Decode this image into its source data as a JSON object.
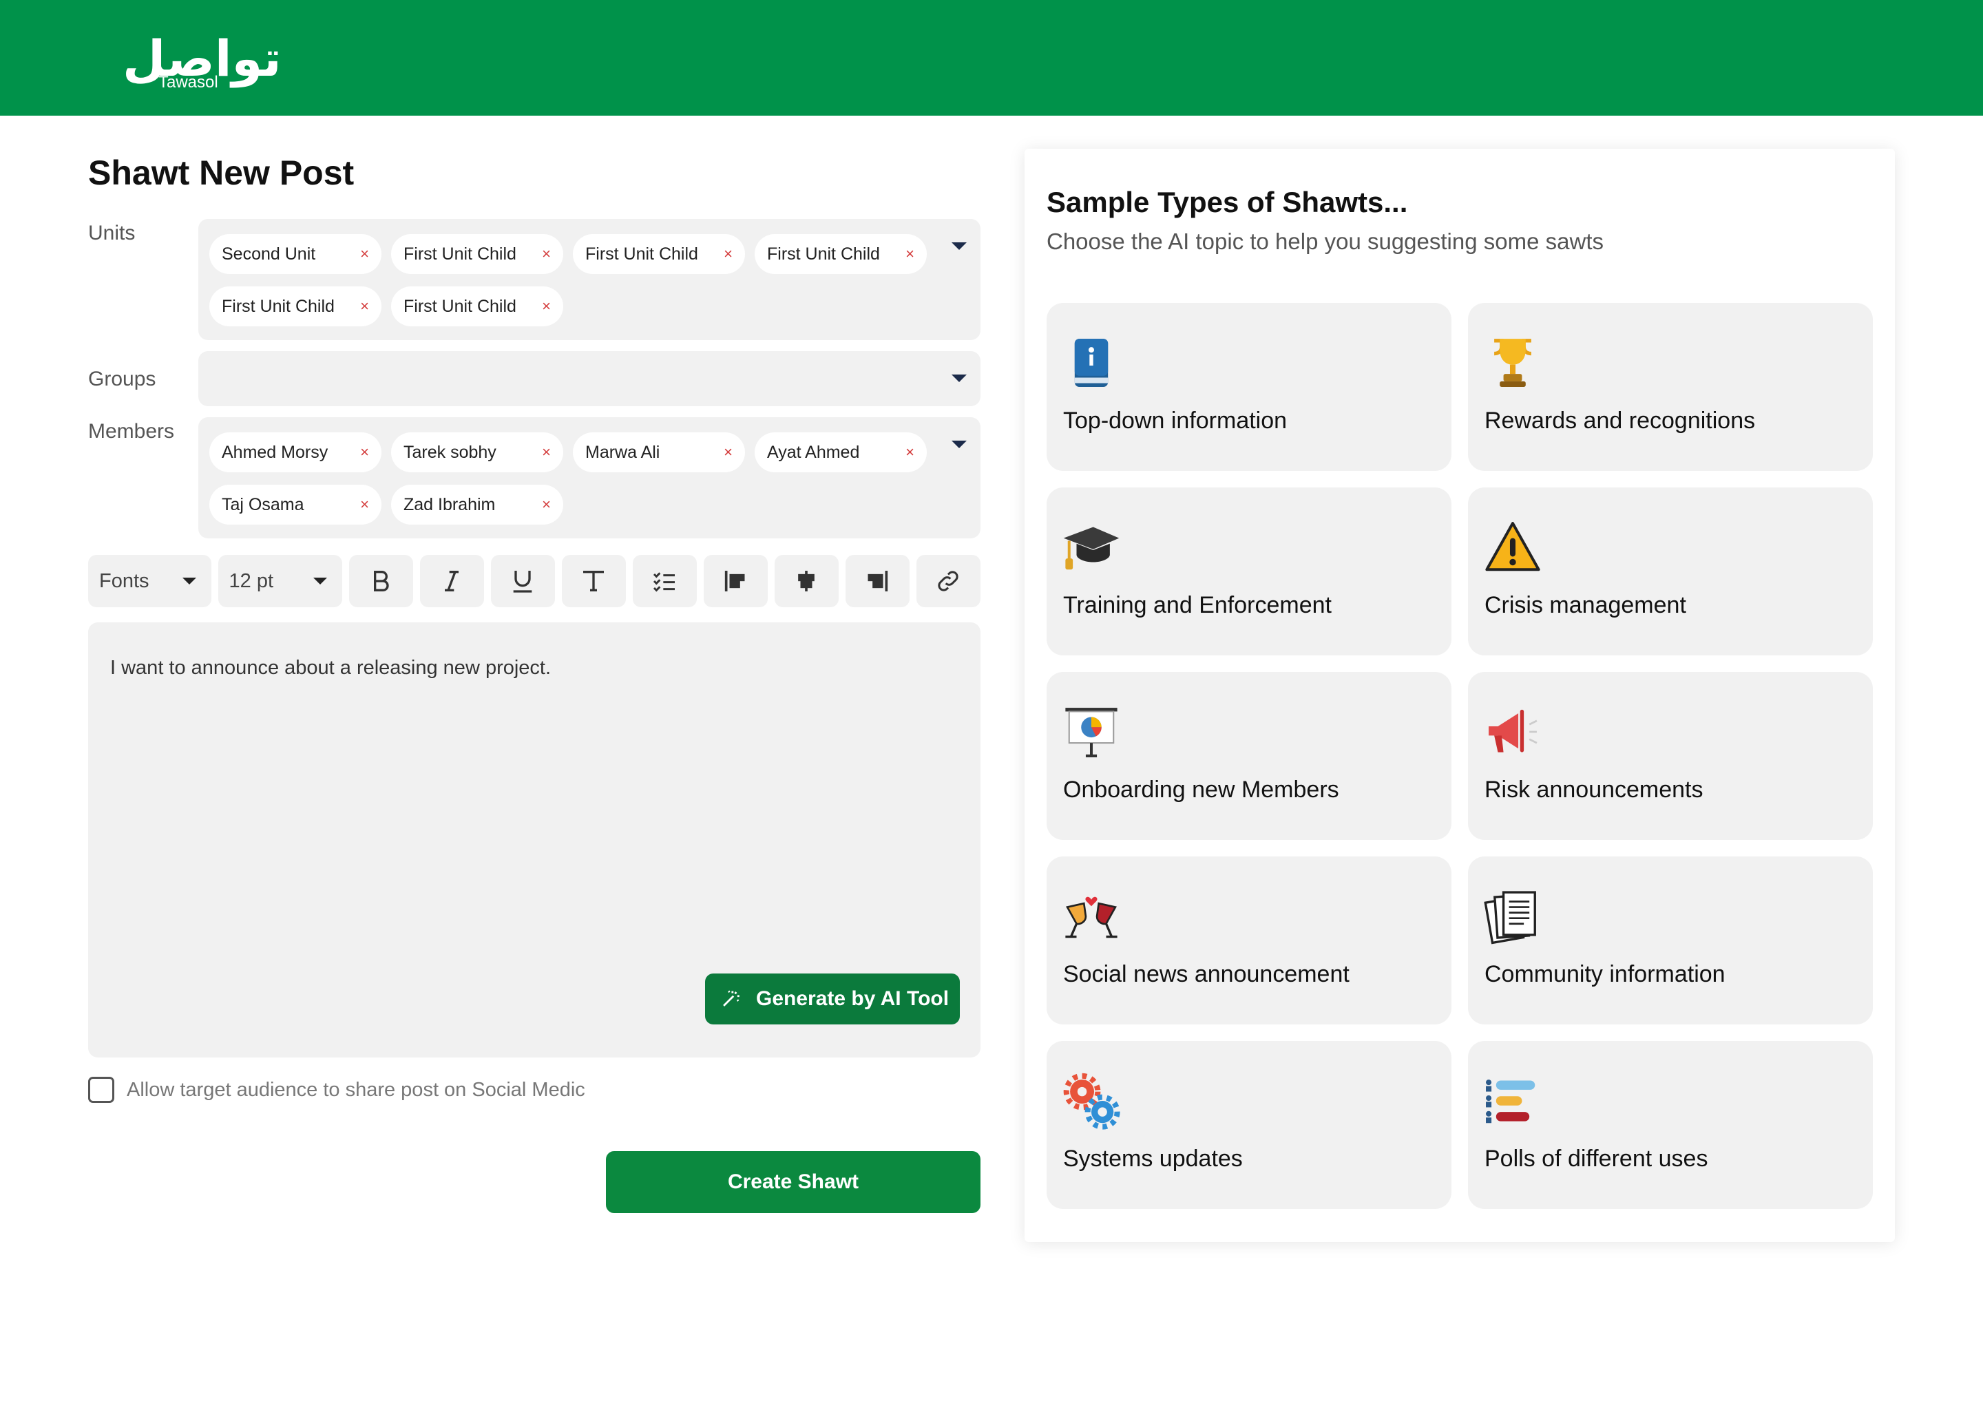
{
  "brand": {
    "logo_arabic": "تواصل",
    "logo_english": "Tawasol",
    "color": "#00924a"
  },
  "page_title": "Shawt New Post",
  "units": {
    "label": "Units",
    "chips": [
      "Second Unit",
      "First Unit Child",
      "First Unit Child",
      "First Unit Child",
      "First Unit Child",
      "First Unit Child"
    ]
  },
  "groups": {
    "label": "Groups",
    "chips": []
  },
  "members": {
    "label": "Members",
    "chips": [
      "Ahmed Morsy",
      "Tarek sobhy",
      "Marwa Ali",
      "Ayat Ahmed",
      "Taj Osama",
      "Zad Ibrahim"
    ]
  },
  "chip_remove_glyph": "×",
  "toolbar": {
    "font_select": "Fonts",
    "size_select": "12 pt",
    "buttons": [
      "bold-icon",
      "italic-icon",
      "underline-icon",
      "text-format-icon",
      "checklist-icon",
      "align-left-icon",
      "align-center-icon",
      "align-right-icon",
      "link-icon"
    ]
  },
  "editor": {
    "text": "I want to announce about a releasing new project."
  },
  "ai_button": {
    "label": "Generate by AI Tool"
  },
  "share_checkbox": {
    "label": "Allow target audience to share post on Social Medic",
    "checked": false
  },
  "create_button": {
    "label": "Create Shawt"
  },
  "samples": {
    "title": "Sample Types of Shawts...",
    "subtitle": "Choose the AI topic to help you suggesting some sawts",
    "cards": [
      {
        "label": "Top-down information",
        "icon": "info-book-icon"
      },
      {
        "label": "Rewards and recognitions",
        "icon": "trophy-icon"
      },
      {
        "label": "Training and Enforcement",
        "icon": "graduation-cap-icon"
      },
      {
        "label": "Crisis management",
        "icon": "warning-icon"
      },
      {
        "label": "Onboarding new Members",
        "icon": "presentation-board-icon"
      },
      {
        "label": "Risk announcements",
        "icon": "megaphone-icon"
      },
      {
        "label": "Social news announcement",
        "icon": "cheers-icon"
      },
      {
        "label": "Community information",
        "icon": "documents-icon"
      },
      {
        "label": "Systems updates",
        "icon": "gears-icon"
      },
      {
        "label": "Polls of different uses",
        "icon": "poll-bars-icon"
      }
    ]
  }
}
